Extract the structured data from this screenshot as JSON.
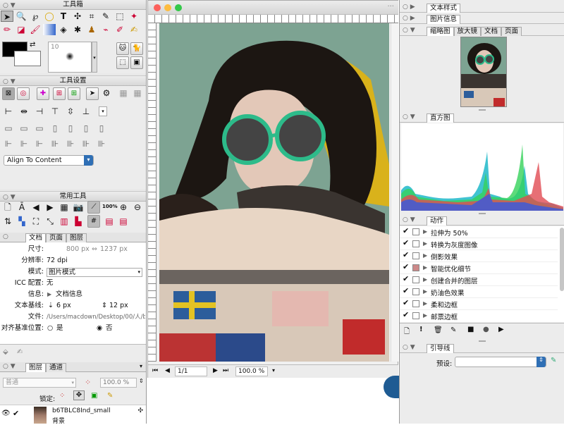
{
  "toolbox": {
    "title": "工具箱",
    "brush_size": "10"
  },
  "toolsettings": {
    "title": "工具设置",
    "align_select": "Align To Content"
  },
  "common": {
    "title": "常用工具",
    "zoom_label": "100%"
  },
  "docinfo": {
    "tabs": [
      "文档",
      "页面",
      "图层"
    ],
    "size_label": "尺寸:",
    "size_w": "800 px",
    "size_h": "1237 px",
    "res_label": "分辨率:",
    "res_value": "72 dpi",
    "mode_label": "模式:",
    "mode_value": "图片模式",
    "icc_label": "ICC 配置:",
    "icc_value": "无",
    "info_label": "信息:",
    "info_value": "文档信息",
    "baseline_label": "文本基线:",
    "baseline_a": "6 px",
    "baseline_b": "12 px",
    "file_label": "文件:",
    "file_value": "/Users/macdown/Desktop/00/人/b",
    "align_label": "对齐基准位置:",
    "yes": "是",
    "no": "否"
  },
  "layers": {
    "tabs": [
      "图层",
      "通道"
    ],
    "blend": "普通",
    "opacity": "100.0 %",
    "lock_label": "锁定:",
    "layer_name": "b6TBLC8Ind_small",
    "layer_sub": "背景"
  },
  "canvas": {
    "page": "1/1",
    "zoom": "100.0 %"
  },
  "right": {
    "text_style": "文本样式",
    "image_info": "图片信息",
    "nav_tabs": [
      "缩略图",
      "放大镜",
      "文档",
      "页面"
    ],
    "histogram": "直方图",
    "actions_title": "动作",
    "actions": [
      "拉伸为 50%",
      "转换为灰度图像",
      "倒影效果",
      "智能优化细节",
      "创建合并的图层",
      "奶油色效果",
      "柔和边框",
      "邮票边框"
    ],
    "guides": "引导线",
    "preset_label": "预设:"
  },
  "colors": {
    "bg_wall": "#7ba391",
    "accent": "#2f6fb5"
  }
}
